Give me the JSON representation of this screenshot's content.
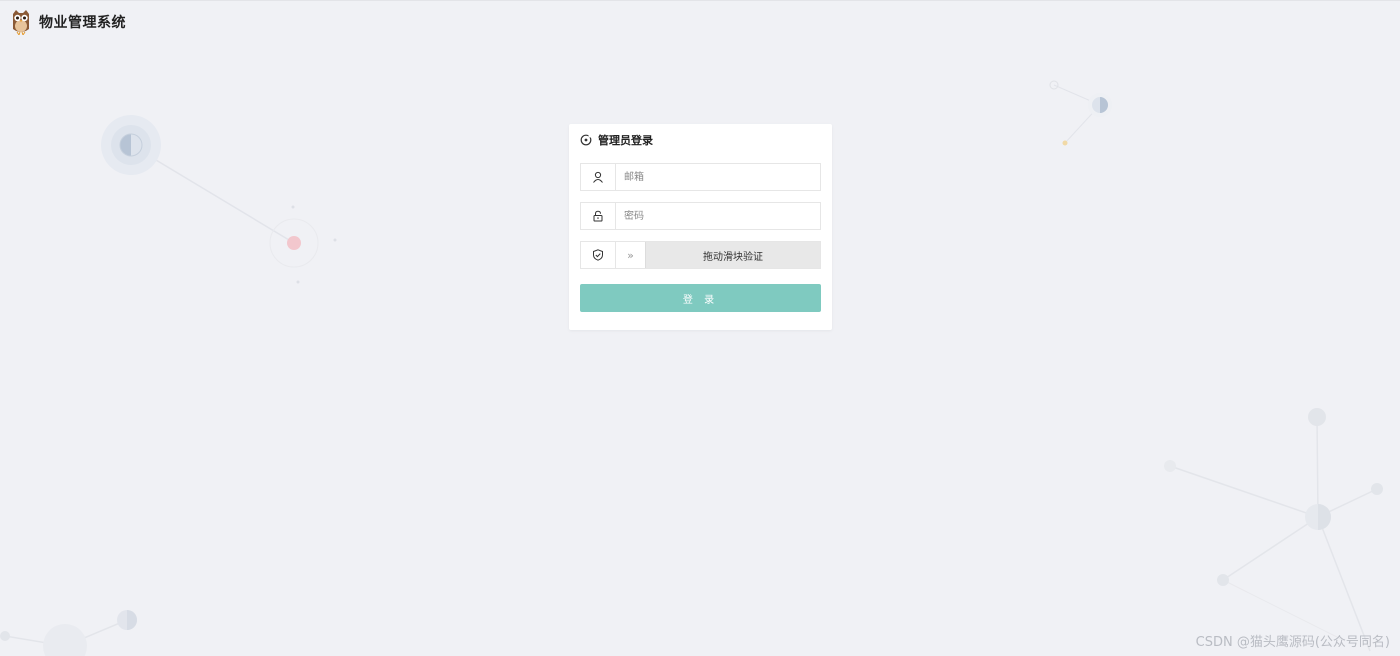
{
  "header": {
    "app_title": "物业管理系统",
    "logo_icon": "owl-logo-icon"
  },
  "login": {
    "title": "管理员登录",
    "title_icon": "admin-icon",
    "email": {
      "placeholder": "邮箱",
      "icon": "user-icon"
    },
    "password": {
      "placeholder": "密码",
      "icon": "lock-icon"
    },
    "captcha": {
      "icon": "shield-icon",
      "handle_glyph": "»",
      "label": "拖动滑块验证"
    },
    "submit_label": "登 录"
  },
  "watermark": "CSDN @猫头鹰源码(公众号同名)",
  "colors": {
    "background": "#f0f1f5",
    "accent": "#7fcac0",
    "card": "#ffffff"
  }
}
